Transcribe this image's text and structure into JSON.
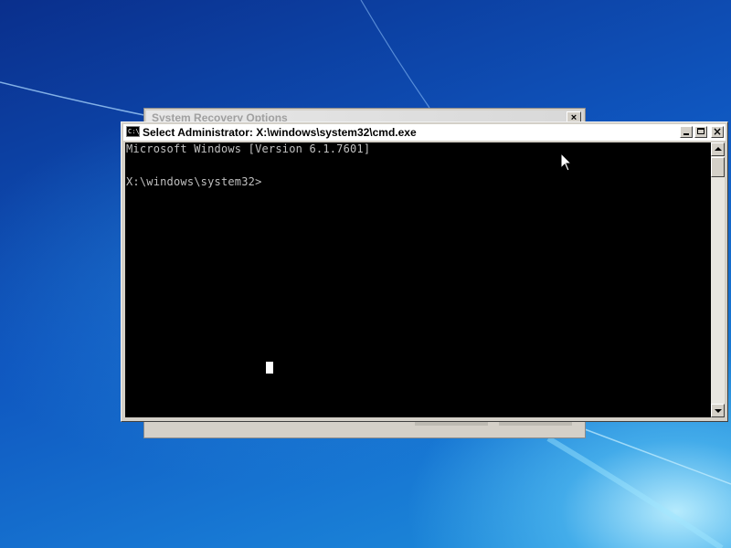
{
  "background_window": {
    "title": "System Recovery Options",
    "close_glyph": "×"
  },
  "cmd_window": {
    "icon_text": "C:\\",
    "title": "Select Administrator: X:\\windows\\system32\\cmd.exe",
    "console_lines": [
      "Microsoft Windows [Version 6.1.7601]",
      "",
      "X:\\windows\\system32>"
    ],
    "close_glyph": "×"
  },
  "colors": {
    "console_bg": "#000000",
    "console_text": "#c0c0c0",
    "desktop_blue": "#0f56bf",
    "chrome_gray": "#d4d0c8"
  },
  "icons": {
    "cmd": "cmd-icon",
    "minimize": "minimize-icon",
    "maximize": "maximize-icon",
    "close": "close-icon",
    "scroll_up": "arrow-up-icon",
    "scroll_down": "arrow-down-icon",
    "pointer": "mouse-pointer-icon"
  }
}
